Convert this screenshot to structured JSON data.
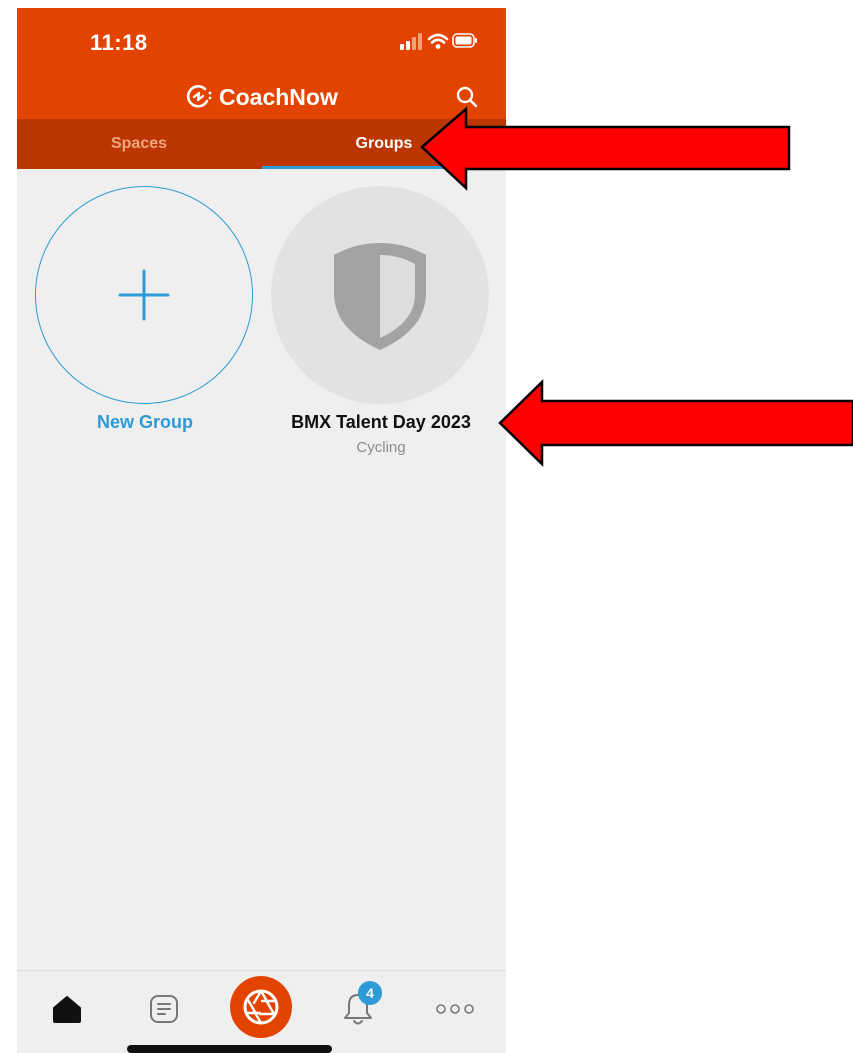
{
  "status_bar": {
    "time": "11:18"
  },
  "header": {
    "brand_name": "CoachNow",
    "logo_icon": "coachnow-logo-icon",
    "search_icon": "search-icon"
  },
  "tabs": [
    {
      "label": "Spaces",
      "active": false
    },
    {
      "label": "Groups",
      "active": true
    }
  ],
  "groups": {
    "new_group": {
      "label": "New Group",
      "icon": "plus-icon"
    },
    "items": [
      {
        "title": "BMX Talent Day 2023",
        "subtitle": "Cycling",
        "icon": "shield-icon"
      }
    ]
  },
  "bottom_nav": {
    "items": [
      {
        "name": "home",
        "icon": "home-icon",
        "active": true
      },
      {
        "name": "feed",
        "icon": "document-icon",
        "active": false
      },
      {
        "name": "camera",
        "icon": "camera-aperture-icon",
        "active": false
      },
      {
        "name": "notifications",
        "icon": "bell-icon",
        "active": false,
        "badge": "4"
      },
      {
        "name": "more",
        "icon": "more-dots-icon",
        "active": false
      }
    ]
  },
  "colors": {
    "brand_orange": "#e24400",
    "tab_bar": "#bb3600",
    "accent_blue": "#2e9ad6",
    "background": "#efefef",
    "annotation_red": "#ff0000"
  }
}
